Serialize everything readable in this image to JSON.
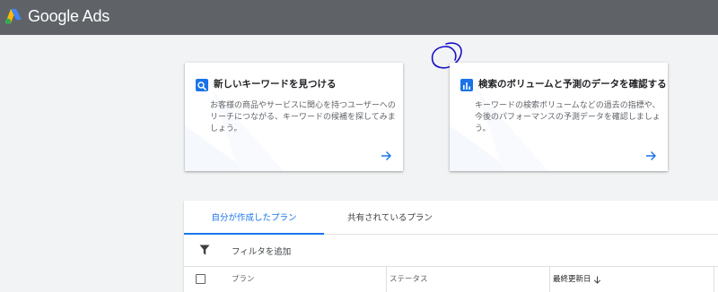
{
  "app": {
    "title": "Google Ads"
  },
  "cards": [
    {
      "icon": "search-icon",
      "title": "新しいキーワードを見つける",
      "description": "お客様の商品やサービスに関心を持つユーザーへのリーチにつながる、キーワードの候補を探してみましょう。",
      "arrow_icon": "arrow-right-icon"
    },
    {
      "icon": "bar-chart-icon",
      "title": "検索のボリュームと予測のデータを確認する",
      "description": "キーワードの検索ボリュームなどの過去の指標や、今後のパフォーマンスの予測データを確認しましょう。",
      "arrow_icon": "arrow-right-icon"
    }
  ],
  "tabs": [
    {
      "label": "自分が作成したプラン",
      "active": true
    },
    {
      "label": "共有されているプラン",
      "active": false
    }
  ],
  "filter": {
    "icon": "filter-icon",
    "label": "フィルタを追加"
  },
  "table": {
    "columns": [
      "プラン",
      "ステータス",
      "最終更新日"
    ],
    "sort_icon": "arrow-down-icon"
  },
  "colors": {
    "accent": "#1a73e8",
    "topbar": "#5f6368",
    "background": "#f1f3f4",
    "annotation": "#1a12c8"
  }
}
